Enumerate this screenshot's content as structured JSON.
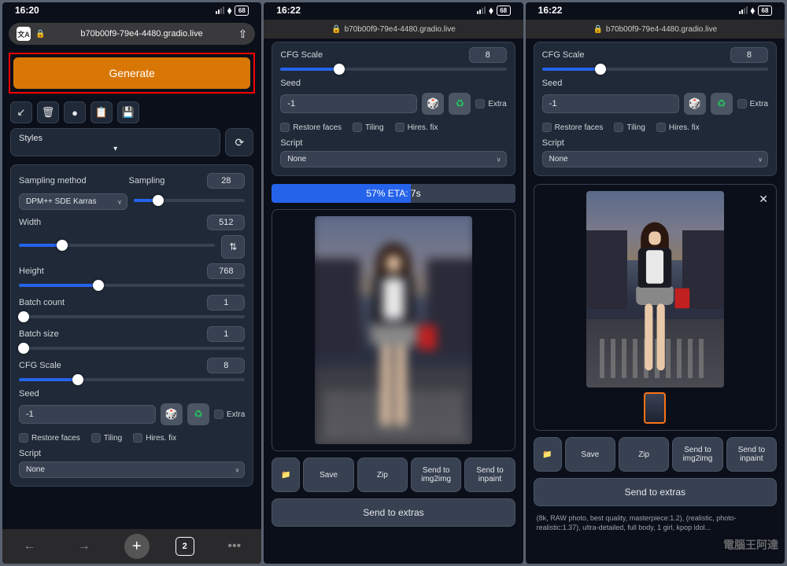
{
  "statusbar": {
    "time1": "16:20",
    "time2": "16:22",
    "time3": "16:22",
    "battery": "68"
  },
  "url": "b70b00f9-79e4-4480.gradio.live",
  "generate_label": "Generate",
  "styles_label": "Styles",
  "sampling_method_label": "Sampling method",
  "sampling_method_value": "DPM++ SDE Karras",
  "sampling_label": "Sampling",
  "sampling_value": "28",
  "width_label": "Width",
  "width_value": "512",
  "height_label": "Height",
  "height_value": "768",
  "batch_count_label": "Batch count",
  "batch_count_value": "1",
  "batch_size_label": "Batch size",
  "batch_size_value": "1",
  "cfg_label": "CFG Scale",
  "cfg_value": "8",
  "seed_label": "Seed",
  "seed_value": "-1",
  "extra_label": "Extra",
  "restore_label": "Restore faces",
  "tiling_label": "Tiling",
  "hires_label": "Hires. fix",
  "script_label": "Script",
  "script_value": "None",
  "progress_text": "57% ETA: 7s",
  "save_label": "Save",
  "zip_label": "Zip",
  "send_img2img": "Send to img2img",
  "send_inpaint": "Send to inpaint",
  "send_extras": "Send to extras",
  "nav_tabs": "2",
  "result_text": "(8k, RAW photo, best quality, masterpiece:1.2), (realistic, photo-realistic:1.37), ultra-detailed, full body, 1 girl, kpop idol...",
  "watermark": "電腦王阿達"
}
